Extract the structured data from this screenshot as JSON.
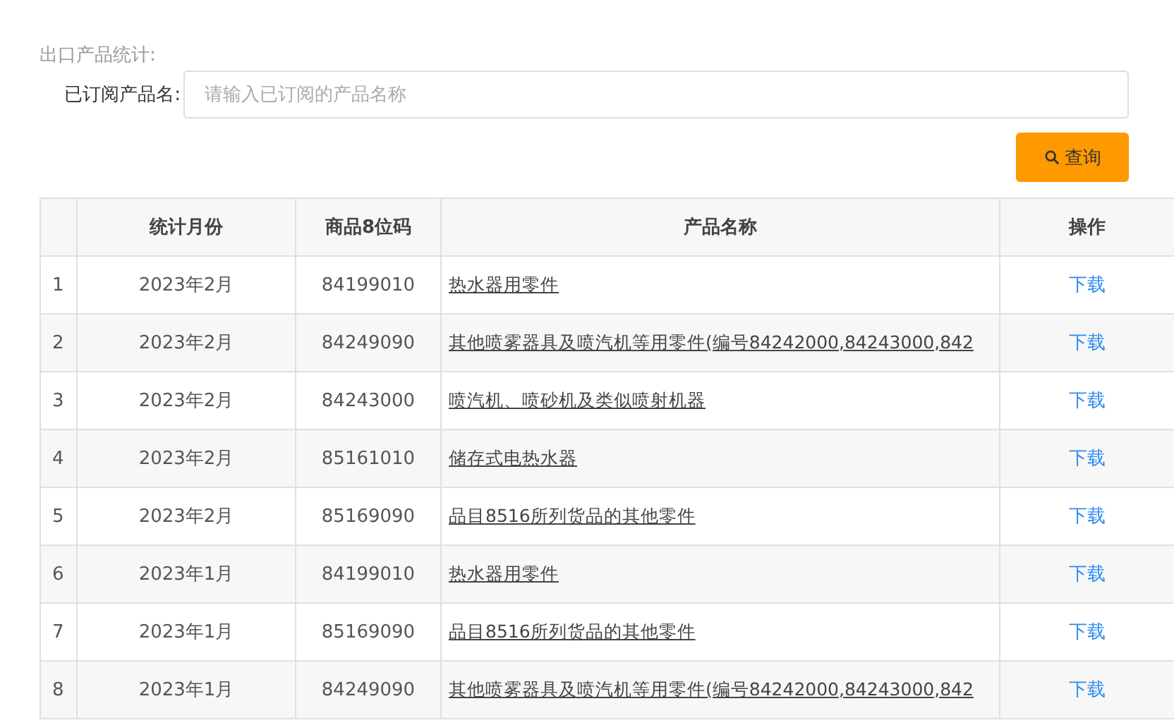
{
  "title": "出口产品统计:",
  "filter": {
    "label": "已订阅产品名:",
    "placeholder": "请输入已订阅的产品名称"
  },
  "search_button": {
    "label": "查询"
  },
  "table": {
    "columns": [
      "",
      "统计月份",
      "商品8位码",
      "产品名称",
      "操作"
    ],
    "rows": [
      {
        "index": "1",
        "month": "2023年2月",
        "code": "84199010",
        "name": "热水器用零件",
        "action": "下载"
      },
      {
        "index": "2",
        "month": "2023年2月",
        "code": "84249090",
        "name": "其他喷雾器具及喷汽机等用零件(编号84242000,84243000,842",
        "action": "下载"
      },
      {
        "index": "3",
        "month": "2023年2月",
        "code": "84243000",
        "name": "喷汽机、喷砂机及类似喷射机器",
        "action": "下载"
      },
      {
        "index": "4",
        "month": "2023年2月",
        "code": "85161010",
        "name": "储存式电热水器",
        "action": "下载"
      },
      {
        "index": "5",
        "month": "2023年2月",
        "code": "85169090",
        "name": "品目8516所列货品的其他零件",
        "action": "下载"
      },
      {
        "index": "6",
        "month": "2023年1月",
        "code": "84199010",
        "name": "热水器用零件",
        "action": "下载"
      },
      {
        "index": "7",
        "month": "2023年1月",
        "code": "85169090",
        "name": "品目8516所列货品的其他零件",
        "action": "下载"
      },
      {
        "index": "8",
        "month": "2023年1月",
        "code": "84249090",
        "name": "其他喷雾器具及喷汽机等用零件(编号84242000,84243000,842",
        "action": "下载"
      }
    ]
  }
}
